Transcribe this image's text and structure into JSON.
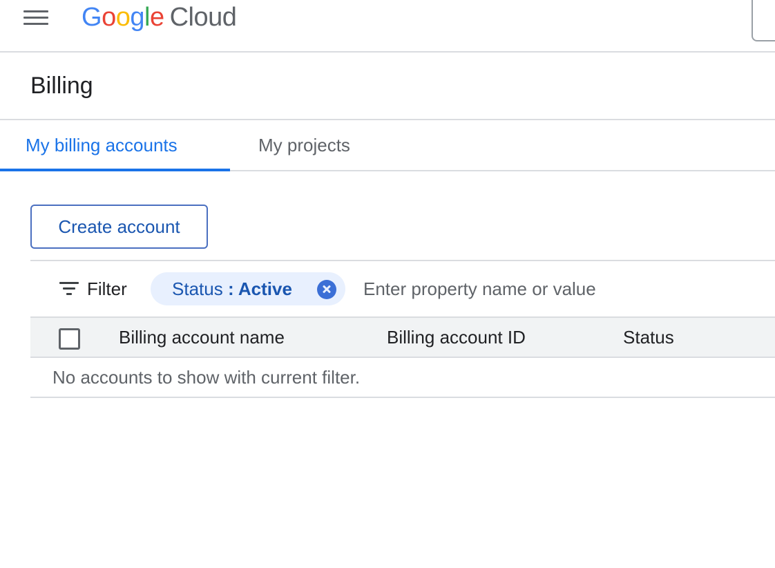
{
  "header": {
    "logo_letters": [
      "G",
      "o",
      "o",
      "g",
      "l",
      "e"
    ],
    "logo_product": "Cloud",
    "colors": {
      "blue": "#4285f4",
      "red": "#ea4335",
      "yellow": "#fbbc05",
      "green": "#34a853"
    }
  },
  "page": {
    "title": "Billing"
  },
  "tabs": [
    {
      "label": "My billing accounts",
      "active": true
    },
    {
      "label": "My projects",
      "active": false
    }
  ],
  "actions": {
    "create_label": "Create account"
  },
  "filter": {
    "label": "Filter",
    "chip": {
      "key": "Status",
      "separator": " : ",
      "value": "Active"
    },
    "placeholder": "Enter property name or value"
  },
  "table": {
    "columns": [
      "Billing account name",
      "Billing account ID",
      "Status"
    ],
    "rows": [],
    "empty_message": "No accounts to show with current filter."
  },
  "icons": {
    "menu": "hamburger-menu-icon",
    "filter": "filter-icon",
    "chip_remove": "close-circle-icon"
  },
  "accent_color": "#1a73e8"
}
